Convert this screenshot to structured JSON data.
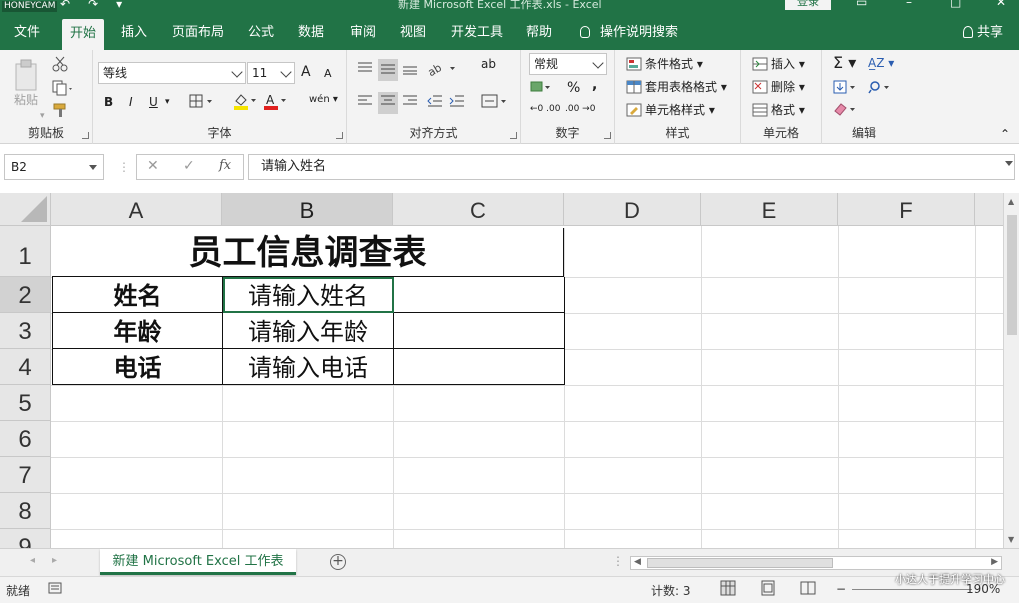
{
  "app": {
    "watermark": "HONEYCAM",
    "doc_title": "新建 Microsoft Excel 工作表.xls  -  Excel",
    "login": "登录"
  },
  "tabs": [
    "文件",
    "开始",
    "插入",
    "页面布局",
    "公式",
    "数据",
    "审阅",
    "视图",
    "开发工具",
    "帮助",
    "操作说明搜索"
  ],
  "active_tab": "开始",
  "share": "共享",
  "ribbon": {
    "clipboard": {
      "label": "剪贴板",
      "paste": "粘贴"
    },
    "font": {
      "label": "字体",
      "name": "等线",
      "size": "11",
      "bold": "B",
      "italic": "I",
      "underline": "U",
      "grow": "A",
      "shrink": "A",
      "phonetic": "wén"
    },
    "alignment": {
      "label": "对齐方式",
      "wrap": "ab"
    },
    "number": {
      "label": "数字",
      "format": "常规",
      "percent": "%",
      "comma": ","
    },
    "styles": {
      "label": "样式",
      "conditional": "条件格式",
      "table": "套用表格格式",
      "cell": "单元格样式"
    },
    "cells": {
      "label": "单元格",
      "insert": "插入",
      "delete": "删除",
      "format": "格式"
    },
    "editing": {
      "label": "编辑"
    }
  },
  "formula_bar": {
    "name_box": "B2",
    "fx": "fx",
    "content": "请输入姓名"
  },
  "columns": [
    "A",
    "B",
    "C",
    "D",
    "E",
    "F"
  ],
  "rows": [
    "1",
    "2",
    "3",
    "4",
    "5",
    "6",
    "7",
    "8",
    "9"
  ],
  "cells": {
    "title": "员工信息调查表",
    "a2": "姓名",
    "b2": "请输入姓名",
    "a3": "年龄",
    "b3": "请输入年龄",
    "a4": "电话",
    "b4": "请输入电话"
  },
  "sheet_tab": "新建 Microsoft Excel 工作表",
  "status": {
    "ready": "就绪",
    "count": "计数: 3",
    "zoom": "190%"
  },
  "overlay_text": "小达人于提升学习中心",
  "colors": {
    "accent": "#217346"
  }
}
